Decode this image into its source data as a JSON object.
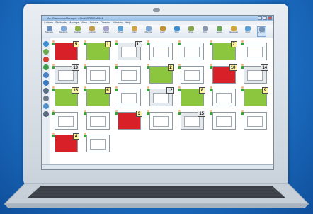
{
  "window": {
    "title": "Ac. ClassroomManager - CLASSROOM 001"
  },
  "menu": {
    "items": [
      "Actions",
      "Students",
      "Manage",
      "View",
      "Journal",
      "Director",
      "Window",
      "Help"
    ]
  },
  "ribbon": {
    "buttons": [
      {
        "label": "Manage",
        "icon": "manage-icon",
        "color": "#6b8fbf"
      },
      {
        "label": "Students",
        "icon": "students-icon",
        "color": "#7fa7d9"
      },
      {
        "label": "Register",
        "icon": "register-icon",
        "color": "#8fb34a"
      },
      {
        "label": "Journal",
        "icon": "journal-icon",
        "color": "#c39a4b"
      },
      {
        "label": "Survey",
        "icon": "survey-icon",
        "color": "#a3a3c9"
      },
      {
        "label": "Show",
        "icon": "show-icon",
        "color": "#5a9fd4"
      },
      {
        "label": "Files",
        "icon": "files-icon",
        "color": "#d0a34a"
      },
      {
        "label": "Monitor",
        "icon": "monitor-icon",
        "color": "#7ba6d6"
      },
      {
        "label": "Lock",
        "icon": "lock-icon",
        "color": "#c1922f"
      },
      {
        "label": "Web",
        "icon": "web-icon",
        "color": "#3e8ed0"
      },
      {
        "label": "Apps",
        "icon": "apps-icon",
        "color": "#87a64c"
      },
      {
        "label": "Print",
        "icon": "print-icon",
        "color": "#8b9aab"
      },
      {
        "label": "Audio",
        "icon": "audio-icon",
        "color": "#6fa85a"
      },
      {
        "label": "Messages",
        "icon": "messages-icon",
        "color": "#d4a53a"
      },
      {
        "label": "Chat",
        "icon": "chat-icon",
        "color": "#5aa0d8"
      },
      {
        "label": "Layout",
        "icon": "layout-icon",
        "color": "#7895b6"
      }
    ]
  },
  "sidebar": {
    "icons": [
      {
        "icon": "home-icon",
        "color": "#3a8fd6"
      },
      {
        "icon": "add-icon",
        "color": "#6aa84f"
      },
      {
        "icon": "stop-icon",
        "color": "#d83a2e"
      },
      {
        "icon": "refresh-icon",
        "color": "#3d9c4a"
      },
      {
        "icon": "users-icon",
        "color": "#4a7fc1"
      },
      {
        "icon": "lock-icon",
        "color": "#3b78c0"
      },
      {
        "icon": "search-icon",
        "color": "#5b6f86"
      },
      {
        "icon": "settings-icon",
        "color": "#6d7c8c"
      },
      {
        "icon": "grid-icon",
        "color": "#4e8fc9"
      },
      {
        "icon": "monitor-icon",
        "color": "#5a6c80"
      }
    ]
  },
  "tiles": [
    {
      "state": "red",
      "badge": "5"
    },
    {
      "state": "green",
      "badge": "1"
    },
    {
      "state": "gray",
      "badge": "11"
    },
    {
      "state": "white",
      "badge": ""
    },
    {
      "state": "white",
      "badge": ""
    },
    {
      "state": "green",
      "badge": "7"
    },
    {
      "state": "white",
      "badge": ""
    },
    {
      "state": "gray",
      "badge": "13"
    },
    {
      "state": "white",
      "badge": ""
    },
    {
      "state": "white",
      "badge": ""
    },
    {
      "state": "green",
      "badge": "2"
    },
    {
      "state": "white",
      "badge": ""
    },
    {
      "state": "red",
      "badge": "10"
    },
    {
      "state": "gray",
      "badge": "14"
    },
    {
      "state": "green",
      "badge": "16"
    },
    {
      "state": "green",
      "badge": "6"
    },
    {
      "state": "white",
      "badge": ""
    },
    {
      "state": "gray",
      "badge": "12"
    },
    {
      "state": "green",
      "badge": "8"
    },
    {
      "state": "white",
      "badge": ""
    },
    {
      "state": "green",
      "badge": "9"
    },
    {
      "state": "white",
      "badge": ""
    },
    {
      "state": "white",
      "badge": ""
    },
    {
      "state": "red",
      "badge": "3"
    },
    {
      "state": "white",
      "badge": ""
    },
    {
      "state": "gray",
      "badge": "15"
    },
    {
      "state": "white",
      "badge": ""
    },
    {
      "state": "white",
      "badge": ""
    },
    {
      "state": "red",
      "badge": "4"
    },
    {
      "state": "white",
      "badge": ""
    }
  ],
  "colors": {
    "green": "#8cc63f",
    "red": "#d72027",
    "badge": "#fff3a0"
  }
}
